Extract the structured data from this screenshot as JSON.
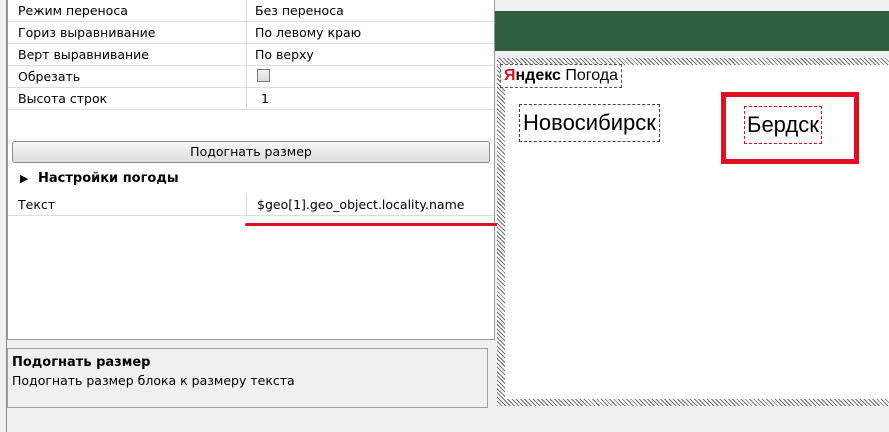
{
  "properties": [
    {
      "label": "Режим переноса",
      "value": "Без переноса"
    },
    {
      "label": "Гориз выравнивание",
      "value": "По левому краю"
    },
    {
      "label": "Верт выравнивание",
      "value": "По верху"
    },
    {
      "label": "Обрезать",
      "value": ""
    },
    {
      "label": "Высота строк",
      "value": "1"
    }
  ],
  "fit_button_label": "Подогнать размер",
  "weather_section": {
    "title": "Настройки погоды",
    "text_label": "Текст",
    "text_value": "$geo[1].geo_object.locality.name"
  },
  "description": {
    "title": "Подогнать размер",
    "text": "Подогнать размер блока к размеру текста"
  },
  "canvas": {
    "brand_ya": "Я",
    "brand_ndex": "ндекс",
    "brand_pogoda": " Погода",
    "city1": "Новосибирск",
    "city2": "Бердск"
  },
  "colors": {
    "header_green": "#2d5e3f",
    "highlight_red": "#e0101e"
  },
  "icons": {
    "section_toggle": "triangle-right-icon",
    "checkbox": "unchecked-checkbox"
  }
}
